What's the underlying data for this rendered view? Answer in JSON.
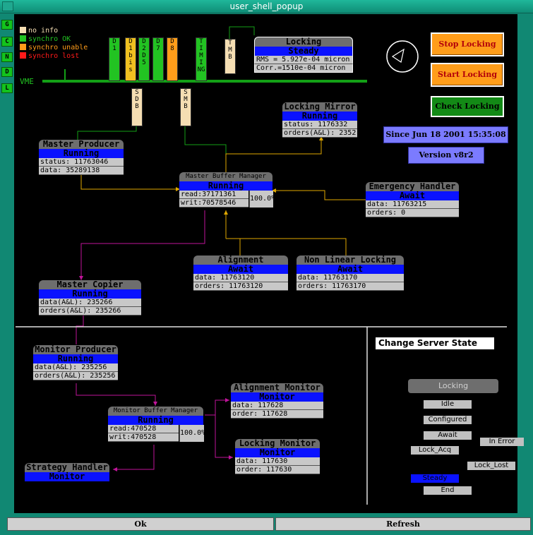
{
  "window": {
    "title": "user_shell_popup"
  },
  "legend": [
    {
      "label": "no info",
      "color": "#f5deb3"
    },
    {
      "label": "synchro OK",
      "color": "#22c322"
    },
    {
      "label": "synchro unable",
      "color": "#ff9d1a"
    },
    {
      "label": "synchro lost",
      "color": "#ff1a1a"
    }
  ],
  "side_indicators": [
    "G",
    "C",
    "N",
    "D",
    "L"
  ],
  "vme_label": "VME",
  "crate_cards": [
    {
      "label": "D1",
      "color": "#22c322"
    },
    {
      "label": "D1 bis",
      "color": "#f0c020"
    },
    {
      "label": "D2 D5",
      "color": "#22c322"
    },
    {
      "label": "D7",
      "color": "#22c322"
    },
    {
      "label": "D8",
      "color": "#ff9d1a"
    },
    {
      "label": "TIMING",
      "color": "#22c322"
    },
    {
      "label": "TMB",
      "color": "#f5deb3"
    },
    {
      "label": "SDB",
      "color": "#f5deb3"
    },
    {
      "label": "SMB",
      "color": "#f5deb3"
    }
  ],
  "locking_panel": {
    "title": "Locking",
    "state": "Steady",
    "rms": "RMS  = 5.927e-04 micron",
    "corr": "Corr.=1510e-04 micron"
  },
  "buttons": {
    "stop_locking": "Stop Locking",
    "start_locking": "Start Locking",
    "check_locking": "Check Locking",
    "ok": "Ok",
    "refresh": "Refresh"
  },
  "since": "Since Jun 18 2001 15:35:08",
  "version": "Version v8r2",
  "nodes": {
    "master_producer": {
      "title": "Master Producer",
      "state": "Running",
      "rows": [
        "status: 11763046",
        "data: 35289138"
      ]
    },
    "locking_mirror": {
      "title": "Locking Mirror",
      "state": "Running",
      "rows": [
        "status: 1176332",
        "orders(A&L): 2352"
      ]
    },
    "master_buffer": {
      "title": "Master Buffer Manager",
      "state": "Running",
      "rows": [
        "read:37171361",
        "writ:70578546"
      ],
      "pct": "100.0%"
    },
    "emergency": {
      "title": "Emergency Handler",
      "state": "Await",
      "rows": [
        "data: 11763215",
        "orders: 0"
      ]
    },
    "alignment": {
      "title": "Alignment",
      "state": "Await",
      "rows": [
        "data: 11763120",
        "orders: 11763120"
      ]
    },
    "non_linear": {
      "title": "Non Linear Locking",
      "state": "Await",
      "rows": [
        "data: 11763170",
        "orders: 11763170"
      ]
    },
    "master_copier": {
      "title": "Master Copier",
      "state": "Running",
      "rows": [
        "data(A&L): 235266",
        "orders(A&L): 235266"
      ]
    },
    "monitor_producer": {
      "title": "Monitor Producer",
      "state": "Running",
      "rows": [
        "data(A&L): 235256",
        "orders(A&L): 235256"
      ]
    },
    "alignment_monitor": {
      "title": "Alignment Monitor",
      "state": "Monitor",
      "rows": [
        "data: 117628",
        "order: 117628"
      ]
    },
    "monitor_buffer": {
      "title": "Monitor Buffer Manager",
      "state": "Running",
      "rows": [
        "read:470528",
        "writ:470528"
      ],
      "pct": "100.0%"
    },
    "locking_monitor": {
      "title": "Locking Monitor",
      "state": "Monitor",
      "rows": [
        "data: 117630",
        "order: 117630"
      ]
    },
    "strategy": {
      "title": "Strategy Handler",
      "state": "Monitor"
    }
  },
  "server_state": {
    "title": "Change Server State",
    "current": "Locking",
    "options": [
      "Idle",
      "Configured",
      "Await",
      "Lock_Acq",
      "In Error",
      "Lock_Lost",
      "Steady",
      "End"
    ],
    "selected": "Steady"
  },
  "colors": {
    "running": "#0a12ff",
    "header": "#6e6e6e",
    "row": "#c8c8c8",
    "link_yellow": "#e0a800",
    "link_magenta": "#c0149a",
    "bus_green": "#13a016"
  }
}
